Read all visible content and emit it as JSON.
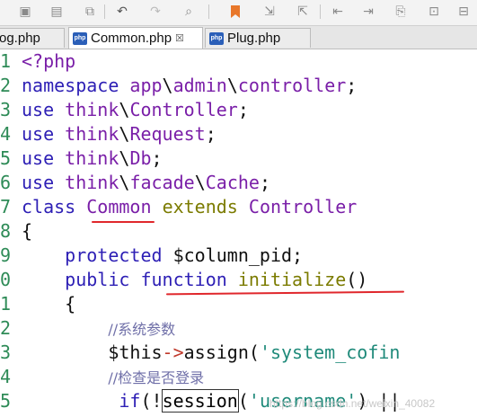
{
  "toolbar": {
    "icons": [
      "save-all-icon",
      "save-icon",
      "export-icon",
      "undo-icon",
      "redo-icon",
      "find-icon",
      "bookmark-icon",
      "indent-icon",
      "outdent-icon",
      "go-start-icon",
      "go-end-icon",
      "comment-icon",
      "uncomment-icon"
    ]
  },
  "tabs": [
    {
      "label": "og.php",
      "active": false
    },
    {
      "label": "Common.php",
      "active": true,
      "close": "☒"
    },
    {
      "label": "Plug.php",
      "active": false
    }
  ],
  "editor": {
    "lines": [
      {
        "num": "1",
        "tokens": [
          [
            "ph",
            "<?php"
          ]
        ]
      },
      {
        "num": "2",
        "tokens": [
          [
            "kw",
            "namespace"
          ],
          [
            "df",
            " "
          ],
          [
            "nm",
            "app"
          ],
          [
            "df",
            "\\"
          ],
          [
            "nm",
            "admin"
          ],
          [
            "df",
            "\\"
          ],
          [
            "nm",
            "controller"
          ],
          [
            "df",
            ";"
          ]
        ]
      },
      {
        "num": "3",
        "tokens": [
          [
            "kw",
            "use"
          ],
          [
            "df",
            " "
          ],
          [
            "nm",
            "think"
          ],
          [
            "df",
            "\\"
          ],
          [
            "nm",
            "Controller"
          ],
          [
            "df",
            ";"
          ]
        ]
      },
      {
        "num": "4",
        "tokens": [
          [
            "kw",
            "use"
          ],
          [
            "df",
            " "
          ],
          [
            "nm",
            "think"
          ],
          [
            "df",
            "\\"
          ],
          [
            "nm",
            "Request"
          ],
          [
            "df",
            ";"
          ]
        ]
      },
      {
        "num": "5",
        "tokens": [
          [
            "kw",
            "use"
          ],
          [
            "df",
            " "
          ],
          [
            "nm",
            "think"
          ],
          [
            "df",
            "\\"
          ],
          [
            "nm",
            "Db"
          ],
          [
            "df",
            ";"
          ]
        ]
      },
      {
        "num": "6",
        "tokens": [
          [
            "kw",
            "use"
          ],
          [
            "df",
            " "
          ],
          [
            "nm",
            "think"
          ],
          [
            "df",
            "\\"
          ],
          [
            "nm",
            "facade"
          ],
          [
            "df",
            "\\"
          ],
          [
            "nm",
            "Cache"
          ],
          [
            "df",
            ";"
          ]
        ]
      },
      {
        "num": "7",
        "tokens": [
          [
            "kw",
            "class"
          ],
          [
            "df",
            " "
          ],
          [
            "nm",
            "Common"
          ],
          [
            "df",
            " "
          ],
          [
            "fn",
            "extends"
          ],
          [
            "df",
            " "
          ],
          [
            "nm",
            "Controller"
          ]
        ]
      },
      {
        "num": "8",
        "tokens": [
          [
            "df",
            "{"
          ]
        ]
      },
      {
        "num": "9",
        "tokens": [
          [
            "df",
            "    "
          ],
          [
            "kw",
            "protected"
          ],
          [
            "df",
            " "
          ],
          [
            "var",
            "$column_pid"
          ],
          [
            "df",
            ";"
          ]
        ]
      },
      {
        "num": "0",
        "tokens": [
          [
            "df",
            "    "
          ],
          [
            "kw",
            "public"
          ],
          [
            "df",
            " "
          ],
          [
            "kw",
            "function"
          ],
          [
            "df",
            " "
          ],
          [
            "fn",
            "initialize"
          ],
          [
            "df",
            "()"
          ]
        ]
      },
      {
        "num": "1",
        "tokens": [
          [
            "df",
            "    {"
          ]
        ]
      },
      {
        "num": "2",
        "tokens": [
          [
            "df",
            "        "
          ],
          [
            "cm",
            "//系统参数"
          ]
        ]
      },
      {
        "num": "3",
        "tokens": [
          [
            "df",
            "        "
          ],
          [
            "var",
            "$this"
          ],
          [
            "op",
            "->"
          ],
          [
            "df",
            "assign("
          ],
          [
            "str",
            "'system_cofin"
          ]
        ]
      },
      {
        "num": "4",
        "tokens": [
          [
            "df",
            "        "
          ],
          [
            "cm",
            "//检查是否登录"
          ]
        ]
      },
      {
        "num": "5",
        "tokens": [
          [
            "df",
            "         "
          ],
          [
            "kw",
            "if"
          ],
          [
            "df",
            "(!"
          ],
          [
            "boxed",
            "session"
          ],
          [
            "df",
            "("
          ],
          [
            "str",
            "'username'"
          ],
          [
            "df",
            ") ||"
          ]
        ]
      }
    ]
  },
  "watermark": "https://blog.csdn.net/weixin_40082"
}
